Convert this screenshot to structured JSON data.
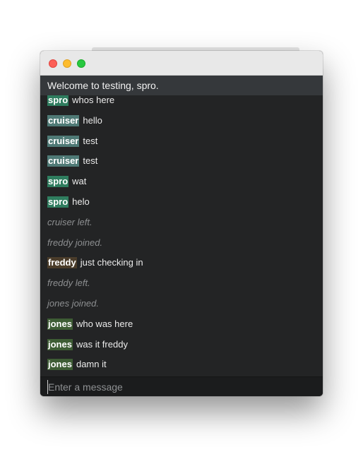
{
  "welcome_text": "Welcome to testing, spro.",
  "composer": {
    "placeholder": "Enter a message"
  },
  "colors": {
    "spro": "#2f7d5f",
    "cruiser": "#4f7a76",
    "freddy": "#4a3c2a",
    "jones": "#3d5c34"
  },
  "messages": [
    {
      "type": "msg",
      "nick": "spro",
      "text": "whos here"
    },
    {
      "type": "msg",
      "nick": "cruiser",
      "text": "hello"
    },
    {
      "type": "msg",
      "nick": "cruiser",
      "text": "test"
    },
    {
      "type": "msg",
      "nick": "cruiser",
      "text": "test"
    },
    {
      "type": "msg",
      "nick": "spro",
      "text": "wat"
    },
    {
      "type": "msg",
      "nick": "spro",
      "text": "helo"
    },
    {
      "type": "event",
      "text": "cruiser left."
    },
    {
      "type": "event",
      "text": "freddy joined."
    },
    {
      "type": "msg",
      "nick": "freddy",
      "text": "just checking in"
    },
    {
      "type": "event",
      "text": "freddy left."
    },
    {
      "type": "event",
      "text": "jones joined."
    },
    {
      "type": "msg",
      "nick": "jones",
      "text": "who was here"
    },
    {
      "type": "msg",
      "nick": "jones",
      "text": "was it freddy"
    },
    {
      "type": "msg",
      "nick": "jones",
      "text": "damn it"
    }
  ]
}
